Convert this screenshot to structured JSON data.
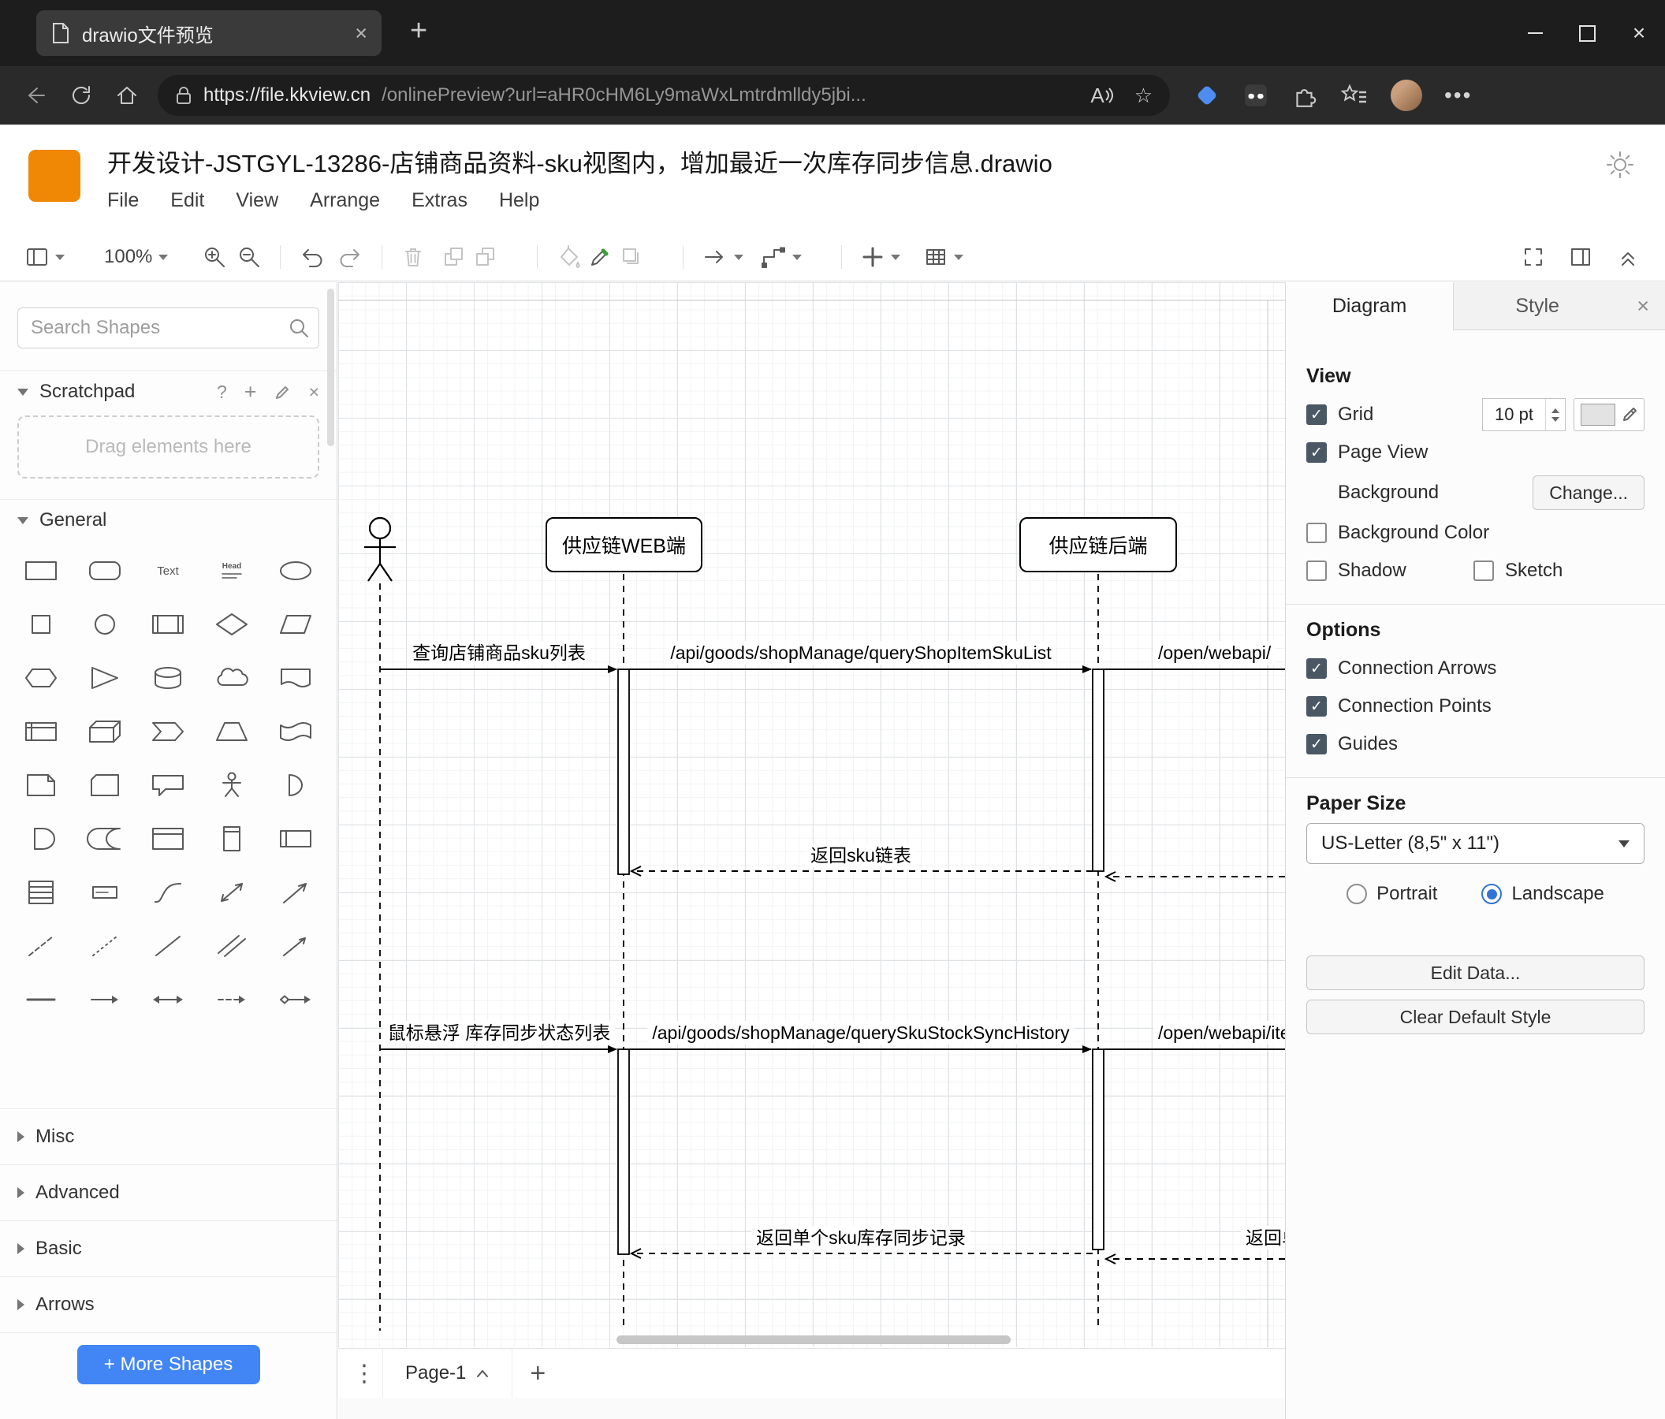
{
  "browser": {
    "tab_title": "drawio文件预览",
    "url_origin": "https://file.kkview.cn",
    "url_path": "/onlinePreview?url=aHR0cHM6Ly9maWxLmtrdmlldy5jbi..."
  },
  "header": {
    "title": "开发设计-JSTGYL-13286-店铺商品资料-sku视图内，增加最近一次库存同步信息.drawio",
    "menus": [
      "File",
      "Edit",
      "View",
      "Arrange",
      "Extras",
      "Help"
    ]
  },
  "toolbar": {
    "zoom_level": "100%"
  },
  "sidebar": {
    "search_placeholder": "Search Shapes",
    "scratchpad_label": "Scratchpad",
    "drop_hint": "Drag elements here",
    "general_label": "General",
    "collapsed_sections": [
      "Misc",
      "Advanced",
      "Basic",
      "Arrows"
    ],
    "more_shapes_label": "+ More Shapes",
    "shapes": [
      "rectangle",
      "rounded-rectangle",
      "text",
      "heading",
      "ellipse",
      "square",
      "circle",
      "process",
      "diamond",
      "parallelogram",
      "hexagon",
      "triangle",
      "cylinder",
      "cloud",
      "document",
      "internal-storage",
      "cube",
      "step",
      "trapezoid",
      "tape",
      "note",
      "card",
      "callout",
      "actor",
      "or",
      "and",
      "data-storage",
      "container",
      "vertical-container",
      "horizontal-pool",
      "list",
      "list-item",
      "curve",
      "bidirectional-arrow",
      "diagonal-arrow",
      "dashed-line",
      "dotted-line",
      "line",
      "double-line",
      "directional-arrow",
      "horizontal-line",
      "horizontal-arrow",
      "horizontal-double-arrow",
      "dashed-horizontal-arrow",
      "diamond-link"
    ]
  },
  "canvas": {
    "page_tab": "Page-1",
    "participants": {
      "web": "供应链WEB端",
      "backend": "供应链后端"
    },
    "labels": {
      "m1": "查询店铺商品sku列表",
      "m2": "/api/goods/shopManage/queryShopItemSkuList",
      "m3": "/open/webapi/",
      "r1": "返回sku链表",
      "m4": "鼠标悬浮 库存同步状态列表",
      "m5": "/api/goods/shopManage/querySkuStockSyncHistory",
      "m6": "/open/webapi/item",
      "r2": "返回单个sku库存同步记录",
      "r3": "返回单个sku库存同步记录"
    }
  },
  "panel": {
    "tabs": [
      "Diagram",
      "Style"
    ],
    "view": {
      "heading": "View",
      "grid_label": "Grid",
      "grid_checked": true,
      "grid_size": "10 pt",
      "page_view_label": "Page View",
      "page_view_checked": true,
      "background_label": "Background",
      "change_button": "Change...",
      "background_color_label": "Background Color",
      "background_color_checked": false,
      "shadow_label": "Shadow",
      "shadow_checked": false,
      "sketch_label": "Sketch",
      "sketch_checked": false
    },
    "options": {
      "heading": "Options",
      "connection_arrows_label": "Connection Arrows",
      "connection_arrows_checked": true,
      "connection_points_label": "Connection Points",
      "connection_points_checked": true,
      "guides_label": "Guides",
      "guides_checked": true
    },
    "paper": {
      "heading": "Paper Size",
      "size_value": "US-Letter (8,5\" x 11\")",
      "portrait_label": "Portrait",
      "portrait_selected": false,
      "landscape_label": "Landscape",
      "landscape_selected": true
    },
    "edit_data_button": "Edit Data...",
    "clear_default_style_button": "Clear Default Style"
  },
  "colors": {
    "logo_orange": "#F08705",
    "primary_button_blue": "#4285F4",
    "checkbox_checked": "#4A5764",
    "grid_swatch": "#E3E3E3"
  }
}
